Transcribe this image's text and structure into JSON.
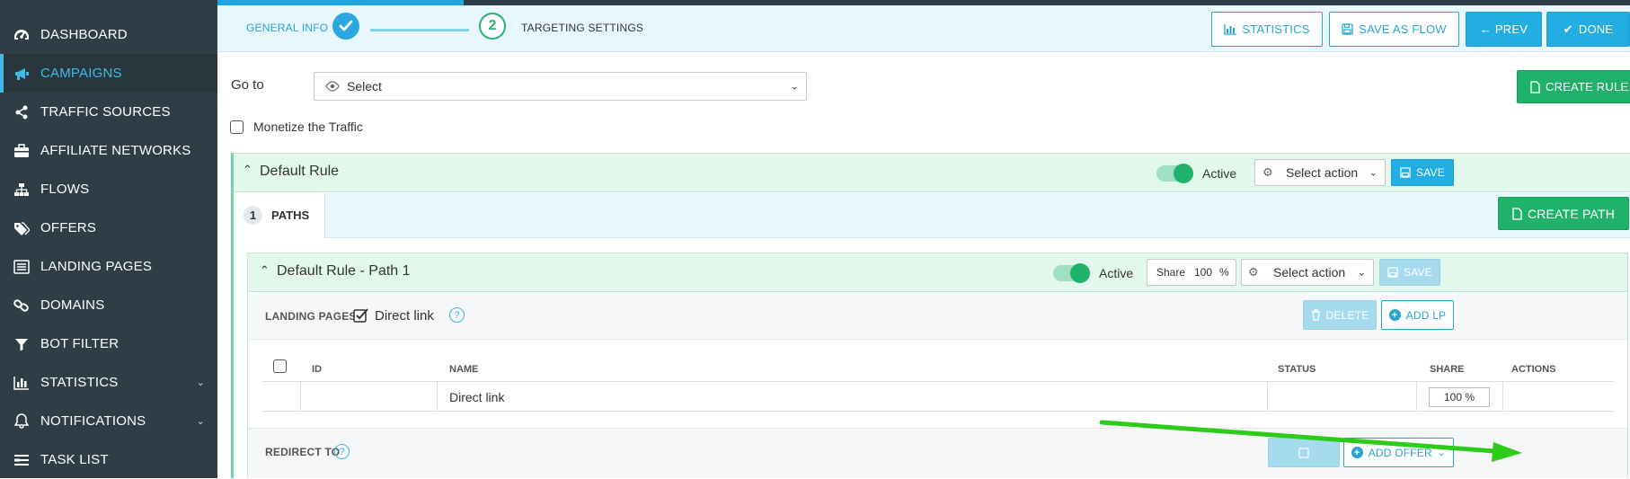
{
  "sidebar": {
    "items": [
      {
        "label": "DASHBOARD",
        "icon": "dashboard-icon"
      },
      {
        "label": "CAMPAIGNS",
        "icon": "megaphone-icon",
        "active": true
      },
      {
        "label": "TRAFFIC SOURCES",
        "icon": "share-icon"
      },
      {
        "label": "AFFILIATE NETWORKS",
        "icon": "briefcase-icon"
      },
      {
        "label": "FLOWS",
        "icon": "sitemap-icon"
      },
      {
        "label": "OFFERS",
        "icon": "tags-icon"
      },
      {
        "label": "LANDING PAGES",
        "icon": "list-icon"
      },
      {
        "label": "DOMAINS",
        "icon": "link-icon"
      },
      {
        "label": "BOT FILTER",
        "icon": "filter-icon"
      },
      {
        "label": "STATISTICS",
        "icon": "bar-chart-icon",
        "has_submenu": true
      },
      {
        "label": "NOTIFICATIONS",
        "icon": "bell-icon",
        "has_submenu": true
      },
      {
        "label": "TASK LIST",
        "icon": "tasks-icon"
      }
    ]
  },
  "wizard": {
    "step1_label": "GENERAL INFO",
    "step2_number": "2",
    "step2_label": "TARGETING SETTINGS"
  },
  "toolbar": {
    "statistics": "STATISTICS",
    "save_as_flow": "SAVE AS FLOW",
    "prev": "← PREV",
    "done": "DONE"
  },
  "goto": {
    "label": "Go to",
    "value": "Select"
  },
  "create_rule": "CREATE RULE",
  "monetize_label": "Monetize the Traffic",
  "rule": {
    "title": "Default Rule",
    "active_label": "Active",
    "action_value": "Select action",
    "save": "SAVE"
  },
  "paths_tab": {
    "count": "1",
    "label": "PATHS"
  },
  "create_path": "CREATE PATH",
  "path": {
    "title": "Default Rule - Path 1",
    "active_label": "Active",
    "share_label": "Share",
    "share_value": "100",
    "share_unit": "%",
    "action_value": "Select action",
    "save": "SAVE"
  },
  "landing": {
    "label": "LANDING PAGES",
    "direct_link_label": "Direct link",
    "help": "?",
    "delete": "DELETE",
    "add_lp": "ADD LP",
    "columns": {
      "id": "ID",
      "name": "NAME",
      "status": "STATUS",
      "share": "SHARE",
      "actions": "ACTIONS"
    },
    "row": {
      "id": "",
      "name": "Direct link",
      "status": "",
      "share": "100 %"
    }
  },
  "redirect": {
    "label": "REDIRECT TO",
    "help": "?",
    "add_offer": "ADD OFFER"
  },
  "colors": {
    "sidebar_bg": "#2f3e46",
    "accent_blue": "#22aee3",
    "accent_green": "#20b26b",
    "arrow_green": "#2ecc1a"
  }
}
